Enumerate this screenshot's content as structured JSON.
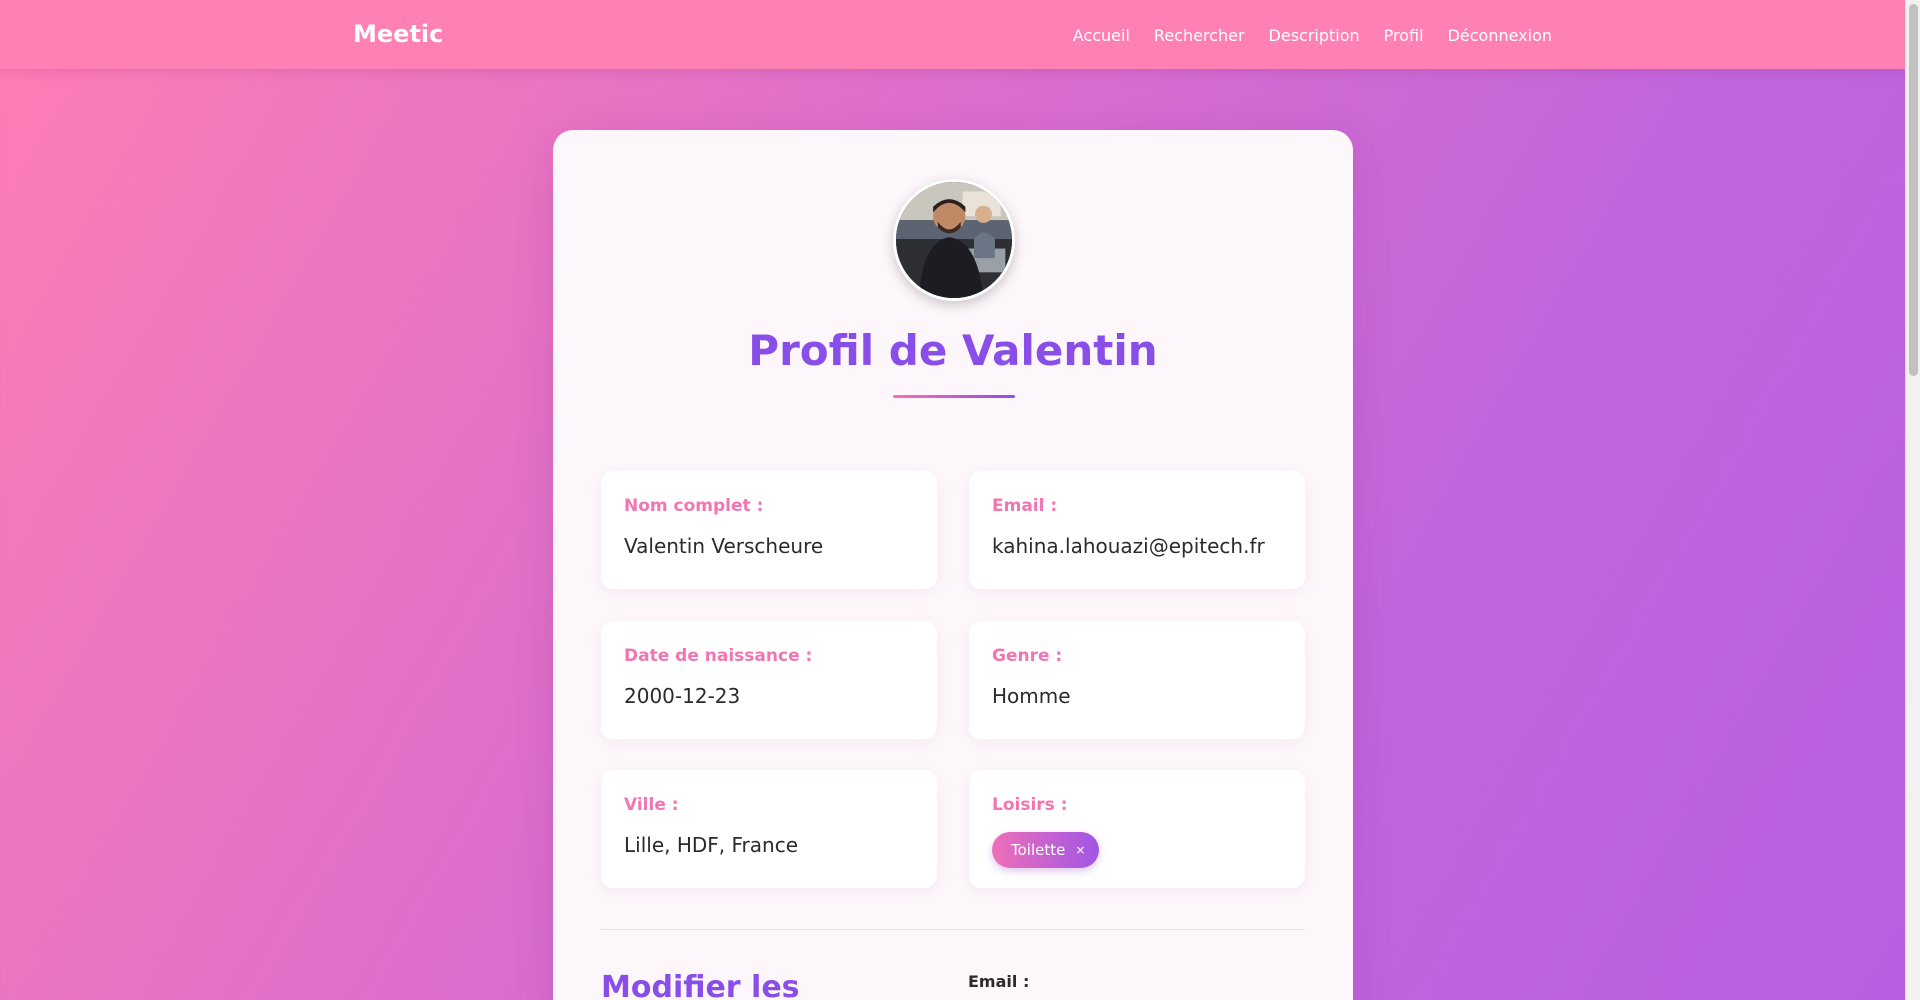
{
  "nav": {
    "brand": "Meetic",
    "links": [
      "Accueil",
      "Rechercher",
      "Description",
      "Profil",
      "Déconnexion"
    ]
  },
  "profile": {
    "avatar_alt": "avatar-photo",
    "title": "Profil de Valentin",
    "fields": {
      "name": {
        "label": "Nom complet :",
        "value": "Valentin Verscheure"
      },
      "email": {
        "label": "Email :",
        "value": "kahina.lahouazi@epitech.fr"
      },
      "birthdate": {
        "label": "Date de naissance :",
        "value": "2000-12-23"
      },
      "gender": {
        "label": "Genre :",
        "value": "Homme"
      },
      "city": {
        "label": "Ville :",
        "value": "Lille, HDF, France"
      },
      "hobbies": {
        "label": "Loisirs :",
        "tags": [
          "Toilette"
        ],
        "remove_symbol": "×"
      }
    }
  },
  "edit": {
    "title": "Modifier les",
    "email_label": "Email :"
  },
  "colors": {
    "nav": "#ff80b5",
    "accent_purple": "#8a4ee8",
    "label_pink": "#f275b2"
  }
}
